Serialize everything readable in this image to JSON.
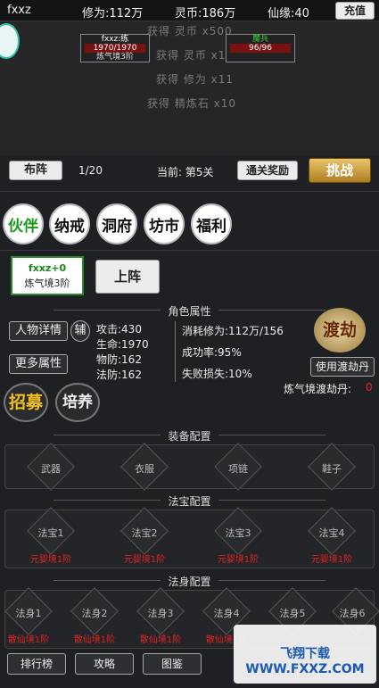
{
  "topbar": {
    "name": "fxxz",
    "cultivation": "修为:112万",
    "spirit_coins": "灵币:186万",
    "immortal_fate": "仙缘:40",
    "recharge": "充值"
  },
  "battle": {
    "log": [
      "获得 灵币 x500",
      "获得 灵币 x14",
      "获得 修为 x11",
      "获得 精炼石 x10"
    ],
    "player": {
      "name": "fxxz:练",
      "hp": "1970/1970",
      "realm": "炼气境3阶"
    },
    "enemy": {
      "name": "魔兵",
      "hp": "96/96"
    }
  },
  "stage": {
    "formation": "布阵",
    "progress": "1/20",
    "current": "当前: 第5关",
    "reward": "通关奖励",
    "challenge": "挑战"
  },
  "nav": [
    "伙伴",
    "纳戒",
    "洞府",
    "坊市",
    "福利"
  ],
  "partner": {
    "name": "fxxz+0",
    "realm": "炼气境3阶",
    "deploy": "上阵"
  },
  "attributes": {
    "title": "角色属性",
    "buttons": {
      "details": "人物详情",
      "assist": "辅",
      "more": "更多属性",
      "recruit": "招募",
      "cultivate": "培养"
    },
    "stats": [
      "攻击:430",
      "生命:1970",
      "物防:162",
      "法防:162"
    ],
    "breakthrough": [
      "消耗修为:112万/156",
      "成功率:95%",
      "失败损失:10%"
    ],
    "tribulation": {
      "title": "渡劫",
      "use_pill": "使用渡劫丹",
      "pill_label": "炼气境渡劫丹:",
      "pill_count": "0"
    }
  },
  "equipment": {
    "title": "装备配置",
    "slots": [
      "武器",
      "衣服",
      "项链",
      "鞋子"
    ]
  },
  "treasure": {
    "title": "法宝配置",
    "slots": [
      "法宝1",
      "法宝2",
      "法宝3",
      "法宝4"
    ],
    "requirement": "元婴境1阶"
  },
  "body": {
    "title": "法身配置",
    "slots": [
      "法身1",
      "法身2",
      "法身3",
      "法身4",
      "法身5",
      "法身6"
    ],
    "requirement": "散仙境1阶"
  },
  "bottom": {
    "ranking": "排行榜",
    "guide": "攻略",
    "compendium": "图鉴"
  },
  "watermark": "飞翔下载 WWW.FXXZ.COM"
}
